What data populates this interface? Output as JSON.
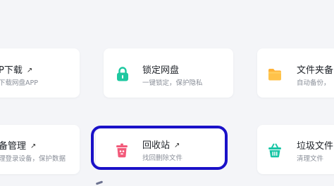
{
  "cards": [
    {
      "id": "app-download",
      "title": "P下载",
      "subtitle": "下载网盘APP"
    },
    {
      "id": "lock-drive",
      "title": "锁定网盘",
      "subtitle": "一键锁定，保护隐私"
    },
    {
      "id": "folder-backup",
      "title": "文件夹备",
      "subtitle": "自动备份，"
    },
    {
      "id": "device-management",
      "title": "备管理",
      "subtitle": "理登录设备，保护数据"
    },
    {
      "id": "recycle-bin",
      "title": "回收站",
      "subtitle": "找回删除文件"
    },
    {
      "id": "junk-files",
      "title": "垃圾文件",
      "subtitle": "清理文件"
    }
  ],
  "link_arrow": "↗",
  "colors": {
    "background": "#f4f5f8",
    "card": "#ffffff",
    "lock_icon": "#1ec8a0",
    "folder_icon": "#ffb238",
    "recycle_icon": "#f25a7a",
    "junk_icon": "#19c6a6",
    "highlight": "#1a11c8"
  }
}
